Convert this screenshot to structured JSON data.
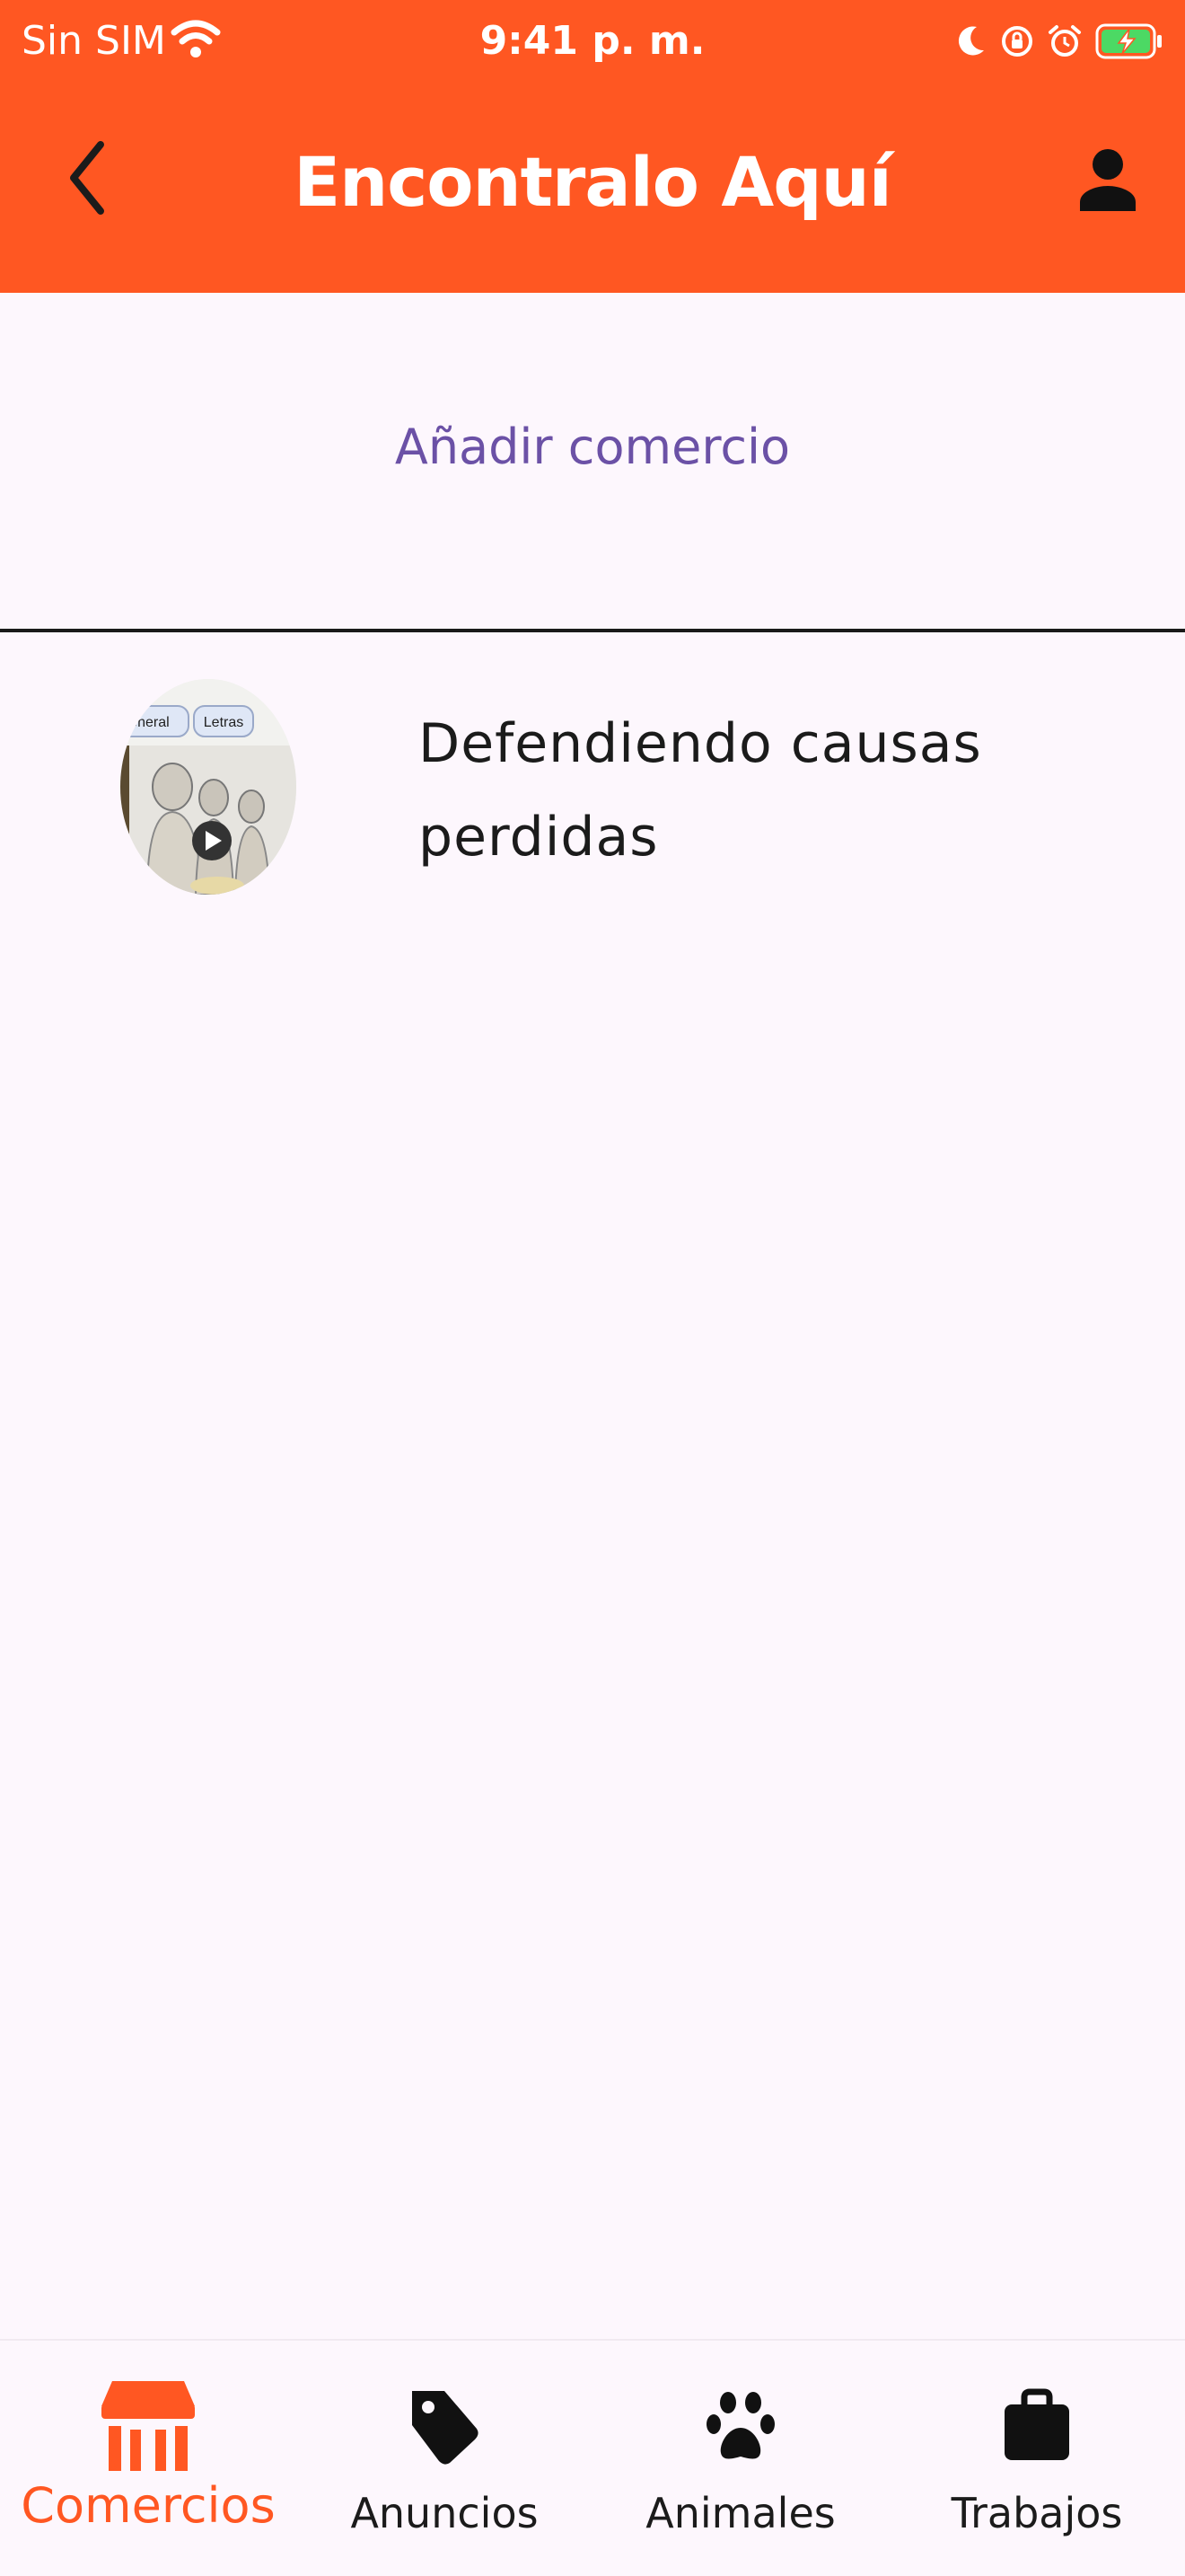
{
  "status_bar": {
    "carrier": "Sin SIM",
    "time": "9:41 p. m.",
    "icons": [
      "wifi-icon",
      "moon-icon",
      "orientation-lock-icon",
      "alarm-icon",
      "battery-charging-icon"
    ]
  },
  "app_bar": {
    "title": "Encontralo Aquí",
    "back_icon": "chevron-left-icon",
    "account_icon": "person-icon"
  },
  "main": {
    "add_link": "Añadir comercio",
    "items": [
      {
        "title": "Defendiendo causas perdidas",
        "thumbnail_chips": [
          "general",
          "Letras"
        ]
      }
    ]
  },
  "bottom_nav": {
    "items": [
      {
        "label": "Comercios",
        "icon": "storefront-icon",
        "active": true
      },
      {
        "label": "Anuncios",
        "icon": "tag-icon",
        "active": false
      },
      {
        "label": "Animales",
        "icon": "paw-icon",
        "active": false
      },
      {
        "label": "Trabajos",
        "icon": "briefcase-icon",
        "active": false
      }
    ]
  },
  "colors": {
    "primary": "#FF5722",
    "background": "#FDF7FD",
    "link": "#6B51A6",
    "battery": "#4CD964"
  }
}
